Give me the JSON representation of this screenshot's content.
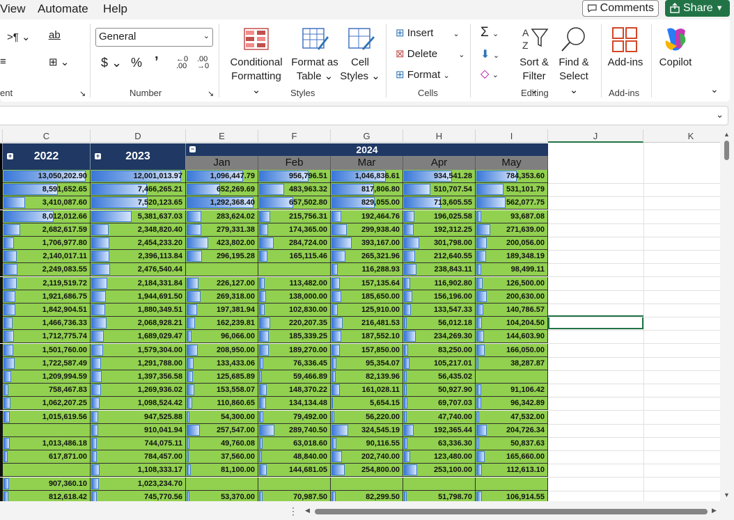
{
  "menu": {
    "view": "View",
    "automate": "Automate",
    "help": "Help",
    "comments": "Comments",
    "share": "Share"
  },
  "ribbon": {
    "alignment_group": "ent",
    "number_format": "General",
    "number_group": "Number",
    "conditional_formatting": [
      "Conditional",
      "Formatting"
    ],
    "format_as_table": [
      "Format as",
      "Table"
    ],
    "cell_styles": [
      "Cell",
      "Styles"
    ],
    "styles_group": "Styles",
    "insert": "Insert",
    "delete": "Delete",
    "format": "Format",
    "cells_group": "Cells",
    "sort_filter": [
      "Sort &",
      "Filter"
    ],
    "find_select": [
      "Find &",
      "Select"
    ],
    "editing_group": "Editing",
    "addins": "Add-ins",
    "addins_group": "Add-ins",
    "copilot": "Copilot"
  },
  "columns": [
    "C",
    "D",
    "E",
    "F",
    "G",
    "H",
    "I",
    "J",
    "K"
  ],
  "headers": {
    "y2022": "2022",
    "y2023": "2023",
    "y2024": "2024",
    "months": [
      "Jan",
      "Feb",
      "Mar",
      "Apr",
      "May"
    ]
  },
  "rows": [
    [
      "13,050,202.90",
      "12,001,013.97",
      "1,096,447.79",
      "956,796.51",
      "1,046,836.61",
      "934,541.28",
      "784,353.60"
    ],
    [
      "8,591,652.65",
      "7,466,265.21",
      "652,269.69",
      "483,963.32",
      "817,806.80",
      "510,707.54",
      "531,101.79"
    ],
    [
      "3,410,087.60",
      "7,520,123.65",
      "1,292,368.40",
      "657,502.80",
      "829,055.00",
      "713,605.55",
      "562,077.75"
    ],
    [
      "8,012,012.66",
      "5,381,637.03",
      "283,624.02",
      "215,756.31",
      "192,464.76",
      "196,025.58",
      "93,687.08"
    ],
    [
      "2,682,617.59",
      "2,348,820.40",
      "279,331.38",
      "174,365.00",
      "299,938.40",
      "192,312.25",
      "271,639.00"
    ],
    [
      "1,706,977.80",
      "2,454,233.20",
      "423,802.00",
      "284,724.00",
      "393,167.00",
      "301,798.00",
      "200,056.00"
    ],
    [
      "2,140,017.11",
      "2,396,113.84",
      "296,195.28",
      "165,115.46",
      "265,321.96",
      "212,640.55",
      "189,348.19"
    ],
    [
      "2,249,083.55",
      "2,476,540.44",
      "",
      "",
      "116,288.93",
      "238,843.11",
      "98,499.11"
    ],
    [
      "2,119,519.72",
      "2,184,331.84",
      "226,127.00",
      "113,482.00",
      "157,135.64",
      "116,902.80",
      "126,500.00"
    ],
    [
      "1,921,686.75",
      "1,944,691.50",
      "269,318.00",
      "138,000.00",
      "185,650.00",
      "156,196.00",
      "200,630.00"
    ],
    [
      "1,842,904.51",
      "1,880,349.51",
      "197,381.94",
      "102,830.00",
      "125,910.00",
      "133,547.33",
      "140,786.57"
    ],
    [
      "1,466,736.33",
      "2,068,928.21",
      "162,239.81",
      "220,207.35",
      "216,481.53",
      "56,012.18",
      "104,204.50"
    ],
    [
      "1,712,775.74",
      "1,689,029.47",
      "96,066.00",
      "185,339.25",
      "187,552.10",
      "234,269.30",
      "144,603.90"
    ],
    [
      "1,501,760.00",
      "1,579,304.00",
      "208,950.00",
      "189,270.00",
      "157,850.00",
      "83,250.00",
      "166,050.00"
    ],
    [
      "1,722,587.49",
      "1,291,788.00",
      "133,433.06",
      "76,336.45",
      "95,354.07",
      "105,217.01",
      "38,287.87"
    ],
    [
      "1,209,994.59",
      "1,397,356.58",
      "125,685.89",
      "59,466.89",
      "82,139.96",
      "56,435.02",
      ""
    ],
    [
      "758,467.83",
      "1,269,936.02",
      "153,558.07",
      "148,370.22",
      "161,028.11",
      "50,927.90",
      "91,106.42"
    ],
    [
      "1,062,207.25",
      "1,098,524.42",
      "110,860.65",
      "134,134.48",
      "5,654.15",
      "69,707.03",
      "96,342.89"
    ],
    [
      "1,015,619.56",
      "947,525.88",
      "54,300.00",
      "79,492.00",
      "56,220.00",
      "47,740.00",
      "47,532.00"
    ],
    [
      "",
      "910,041.94",
      "257,547.00",
      "289,740.50",
      "324,545.19",
      "192,365.44",
      "204,726.34"
    ],
    [
      "1,013,486.18",
      "744,075.11",
      "49,760.08",
      "63,018.60",
      "90,116.55",
      "63,336.30",
      "50,837.63"
    ],
    [
      "617,871.00",
      "784,457.00",
      "37,560.00",
      "48,840.00",
      "202,740.00",
      "123,480.00",
      "165,660.00"
    ],
    [
      "",
      "1,108,333.17",
      "81,100.00",
      "144,681.05",
      "254,800.00",
      "253,100.00",
      "112,613.10"
    ],
    [
      "907,360.10",
      "1,023,234.70",
      "",
      "",
      "",
      "",
      ""
    ],
    [
      "812,618.42",
      "745,770.56",
      "53,370.00",
      "70,987.50",
      "82,299.50",
      "51,798.70",
      "106,914.55"
    ]
  ],
  "colors": {
    "header_navy": "#1f3864",
    "cell_green": "#92d050",
    "databar_blue": "#3a78d8",
    "share_green": "#217346"
  }
}
